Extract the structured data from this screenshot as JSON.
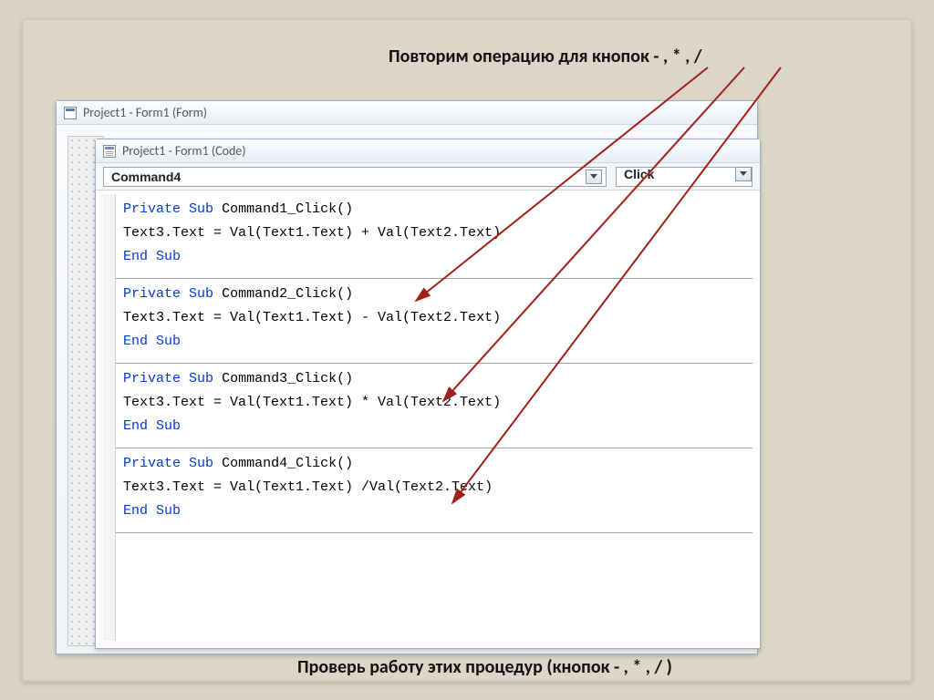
{
  "heading_top": "Повторим  операцию для кнопок  - , * , /",
  "heading_bottom": "Проверь работу этих процедур (кнопок  - , * , / )",
  "form_window_title": "Project1 - Form1 (Form)",
  "code_window_title": "Project1 - Form1 (Code)",
  "object_selector": "Command4",
  "proc_selector": "Click",
  "kw": {
    "private": "Private",
    "sub": "Sub",
    "end": "End",
    "endsub": "Sub"
  },
  "procs": [
    {
      "name": "Command1_Click()",
      "body": "Text3.Text = Val(Text1.Text) + Val(Text2.Text)"
    },
    {
      "name": "Command2_Click()",
      "body": "Text3.Text = Val(Text1.Text) - Val(Text2.Text)"
    },
    {
      "name": "Command3_Click()",
      "body": "Text3.Text = Val(Text1.Text) * Val(Text2.Text)"
    },
    {
      "name": "Command4_Click()",
      "body": "Text3.Text = Val(Text1.Text) /Val(Text2.Text)"
    }
  ]
}
